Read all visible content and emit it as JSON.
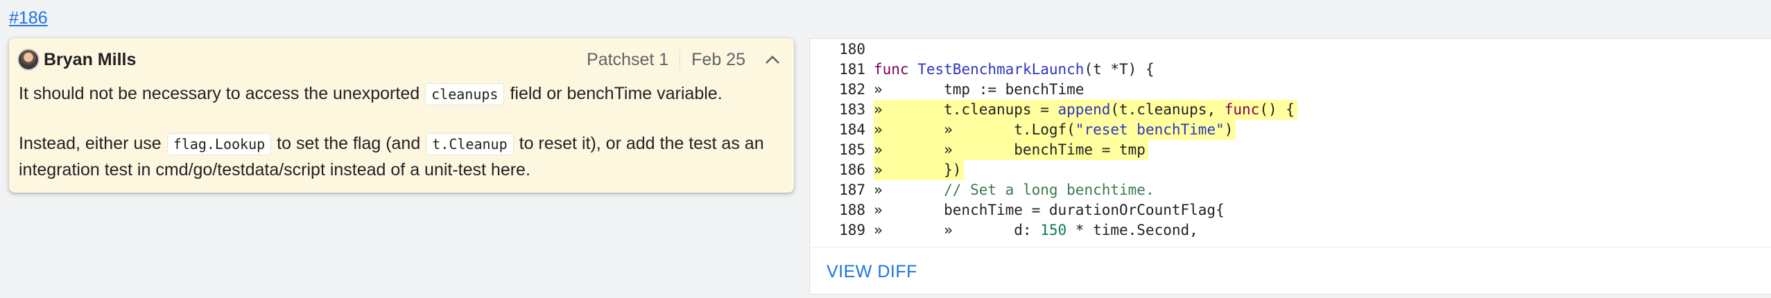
{
  "ref_link": "#186",
  "comment": {
    "author": "Bryan Mills",
    "patchset": "Patchset 1",
    "date": "Feb 25",
    "para1": {
      "before": "It should not be necessary to access the unexported",
      "code": "cleanups",
      "after": "field or benchTime variable."
    },
    "para2": {
      "part1": "Instead, either use",
      "code1": "flag.Lookup",
      "part2": "to set the flag (and",
      "code2": "t.Cleanup",
      "part3": "to reset it), or add the test as an integration test in cmd/go/testdata/script instead of a unit-test here."
    }
  },
  "code": {
    "lines": [
      {
        "n": "180",
        "text": "",
        "hl": false
      },
      {
        "n": "181",
        "text": "func TestBenchmarkLaunch(t *T) {",
        "hl": false
      },
      {
        "n": "182",
        "text": "»       tmp := benchTime",
        "hl": false
      },
      {
        "n": "183",
        "text": "»       t.cleanups = append(t.cleanups, func() {",
        "hl": true
      },
      {
        "n": "184",
        "text": "»       »       t.Logf(\"reset benchTime\")",
        "hl": true
      },
      {
        "n": "185",
        "text": "»       »       benchTime = tmp",
        "hl": true
      },
      {
        "n": "186",
        "text": "»       })",
        "hl": true
      },
      {
        "n": "187",
        "text": "»       // Set a long benchtime.",
        "hl": false
      },
      {
        "n": "188",
        "text": "»       benchTime = durationOrCountFlag{",
        "hl": false
      },
      {
        "n": "189",
        "text": "»       »       d: 150 * time.Second,",
        "hl": false
      }
    ]
  },
  "view_diff_label": "VIEW DIFF"
}
